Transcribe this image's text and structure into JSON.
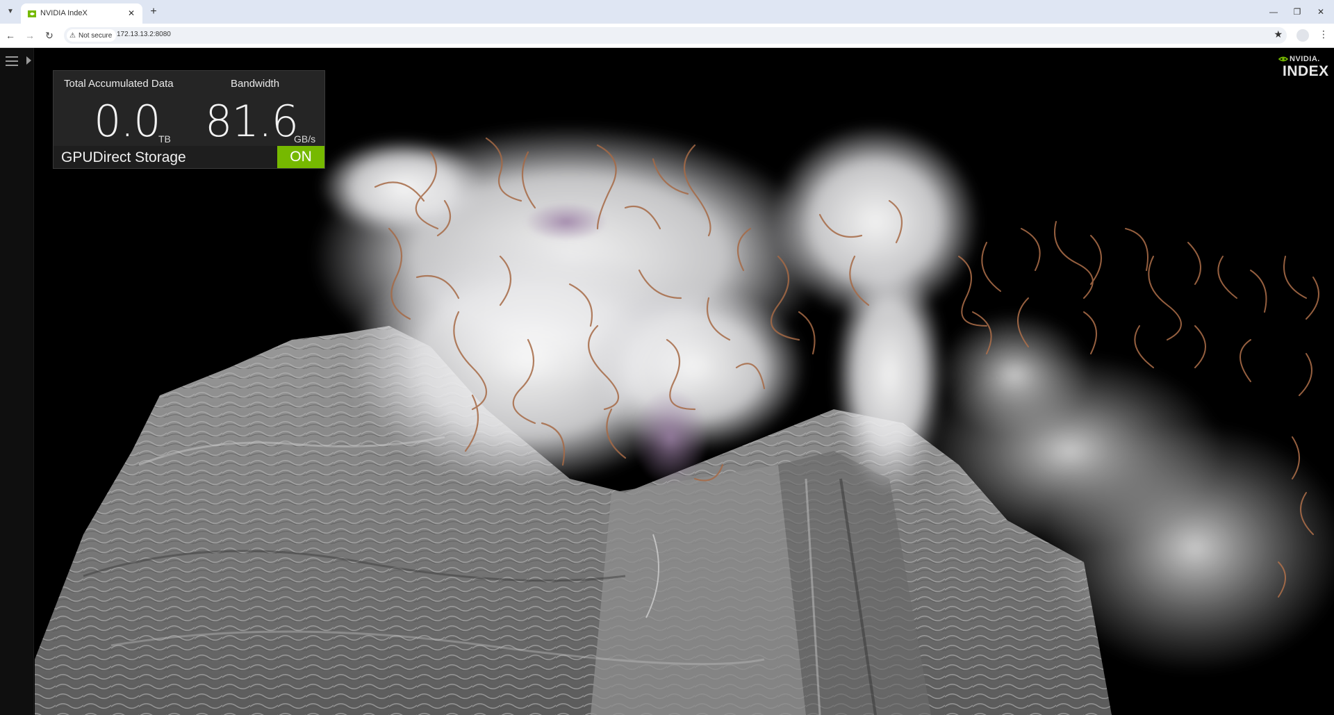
{
  "browser": {
    "tab_title": "NVIDIA IndeX",
    "new_tab_glyph": "+",
    "close_glyph": "✕",
    "security_label": "Not secure",
    "url": "172.13.13.2:8080",
    "window_controls": {
      "minimize": "—",
      "restore": "❐",
      "close": "✕"
    }
  },
  "app": {
    "stats": {
      "total_accumulated_label": "Total Accumulated Data",
      "total_accumulated_value": "0.0",
      "total_accumulated_unit": "TB",
      "bandwidth_label": "Bandwidth",
      "bandwidth_value": "81.6",
      "bandwidth_unit": "GB/s"
    },
    "gpudirect": {
      "label": "GPUDirect Storage",
      "state": "ON",
      "state_color": "#76b900"
    },
    "logo": {
      "brand": "NVIDIA.",
      "product": "INDEX"
    }
  },
  "icons": {
    "tab_menu": "chevron-down-icon",
    "back": "back-arrow-icon",
    "forward": "forward-arrow-icon",
    "reload": "reload-icon",
    "warning": "warning-icon",
    "bookmark": "star-icon",
    "profile": "profile-icon",
    "menu": "kebab-icon",
    "sidebar_toggle": "hamburger-icon",
    "sidebar_expand": "expand-arrow-icon"
  }
}
